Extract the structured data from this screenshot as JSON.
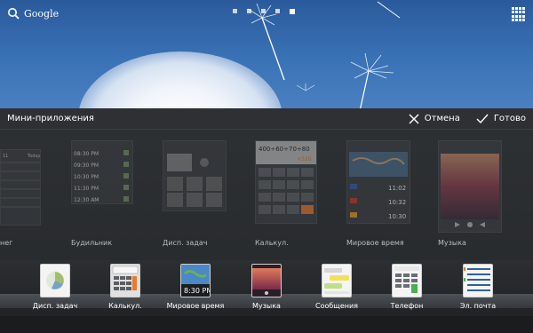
{
  "home": {
    "search_label": "Google",
    "page_count": 5,
    "active_page": 5
  },
  "panel": {
    "title": "Мини-приложения",
    "cancel_label": "Отмена",
    "done_label": "Готово"
  },
  "widgets": [
    {
      "label": "нег",
      "icon": "calendar-widget"
    },
    {
      "label": "Будильник",
      "icon": "alarm-widget"
    },
    {
      "label": "Дисп. задач",
      "icon": "task-manager-widget"
    },
    {
      "label": "Калькул.",
      "icon": "calculator-widget"
    },
    {
      "label": "Мировое время",
      "icon": "world-clock-widget"
    },
    {
      "label": "Музыка",
      "icon": "music-widget"
    }
  ],
  "alarm_widget": {
    "times": [
      "08:30 PM",
      "09:30 PM",
      "10:30 PM",
      "11:30 PM",
      "12:30 AM"
    ]
  },
  "calculator_widget": {
    "display": "400÷60÷70÷80",
    "result": "×520"
  },
  "world_clock_widget": {
    "times": [
      "11:02",
      "10:32",
      "10:30"
    ]
  },
  "dock": [
    {
      "label": "Дисп. задач",
      "icon": "task-manager-icon"
    },
    {
      "label": "Калькул.",
      "icon": "calculator-icon"
    },
    {
      "label": "Мировое время",
      "icon": "world-clock-icon"
    },
    {
      "label": "Музыка",
      "icon": "music-icon"
    },
    {
      "label": "Сообщения",
      "icon": "messages-icon"
    },
    {
      "label": "Телефон",
      "icon": "phone-icon"
    },
    {
      "label": "Эл. почта",
      "icon": "email-icon"
    }
  ],
  "dock_world_clock": {
    "time": "8:30 PM"
  },
  "colors": {
    "wallpaper": "#3a72b6",
    "panel": "#2e3134",
    "accent_orange": "#e67a2e"
  }
}
